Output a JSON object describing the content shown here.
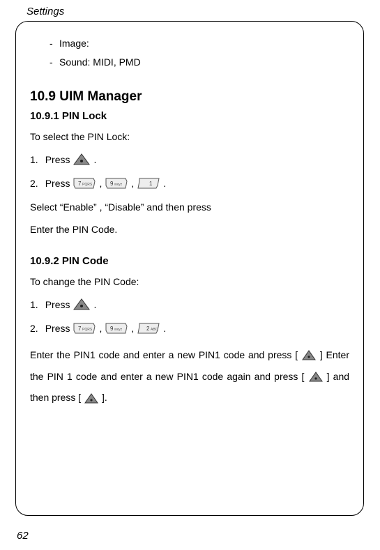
{
  "header": "Settings",
  "bullets": {
    "b1": "Image:",
    "b2": "Sound: MIDI, PMD"
  },
  "sec109": {
    "title": "10.9 UIM Manager",
    "sub1": {
      "title": "10.9.1 PIN Lock",
      "intro": "To select the PIN Lock:",
      "step1_pre": "1.",
      "step1_txt": "Press",
      "step2_pre": "2.",
      "step2_txt": "Press",
      "after1": "Select “Enable” , “Disable” and then press",
      "after2": "Enter the PIN Code."
    },
    "sub2": {
      "title": "10.9.2 PIN Code",
      "intro": "To change the PIN Code:",
      "step1_pre": "1.",
      "step1_txt": "Press",
      "step2_pre": "2.",
      "step2_txt": "Press",
      "para_a": "Enter the PIN1 code and enter a new PIN1 code and press [",
      "para_b": "] Enter the PIN 1 code and enter a new PIN1 code again and press [",
      "para_c": "] and then press [",
      "para_d": "]."
    }
  },
  "page": "62"
}
